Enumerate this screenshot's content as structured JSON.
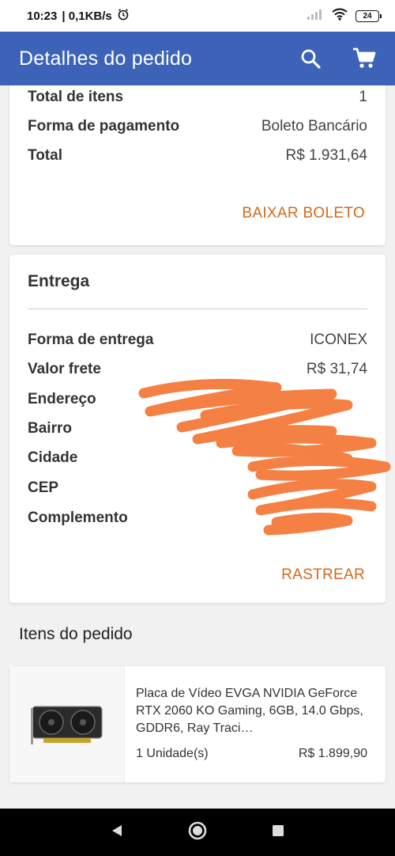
{
  "status_bar": {
    "time": "10:23",
    "network": "| 0,1KB/s",
    "battery": "24"
  },
  "app_bar": {
    "title": "Detalhes do pedido",
    "search_icon": "search-icon",
    "cart_icon": "shopping-cart-icon"
  },
  "payment": {
    "total_items_label": "Total de itens",
    "total_items_value": "1",
    "payment_method_label": "Forma de pagamento",
    "payment_method_value": "Boleto Bancário",
    "total_label": "Total",
    "total_value": "R$ 1.931,64",
    "download_label": "BAIXAR BOLETO"
  },
  "delivery": {
    "title": "Entrega",
    "method_label": "Forma de entrega",
    "method_value": "ICONEX",
    "shipping_label": "Valor frete",
    "shipping_value": "R$ 31,74",
    "address_label": "Endereço",
    "neighborhood_label": "Bairro",
    "city_label": "Cidade",
    "zip_label": "CEP",
    "complement_label": "Complemento",
    "track_label": "RASTREAR"
  },
  "items": {
    "heading": "Itens do pedido",
    "list": [
      {
        "name": "Placa de Vídeo EVGA NVIDIA GeForce RTX 2060 KO Gaming, 6GB, 14.0 Gbps, GDDR6, Ray Traci…",
        "quantity": "1 Unidade(s)",
        "price": "R$ 1.899,90"
      }
    ]
  },
  "colors": {
    "app_bar": "#3c63b8",
    "accent": "#d2691e",
    "redaction": "#f47a3a"
  }
}
